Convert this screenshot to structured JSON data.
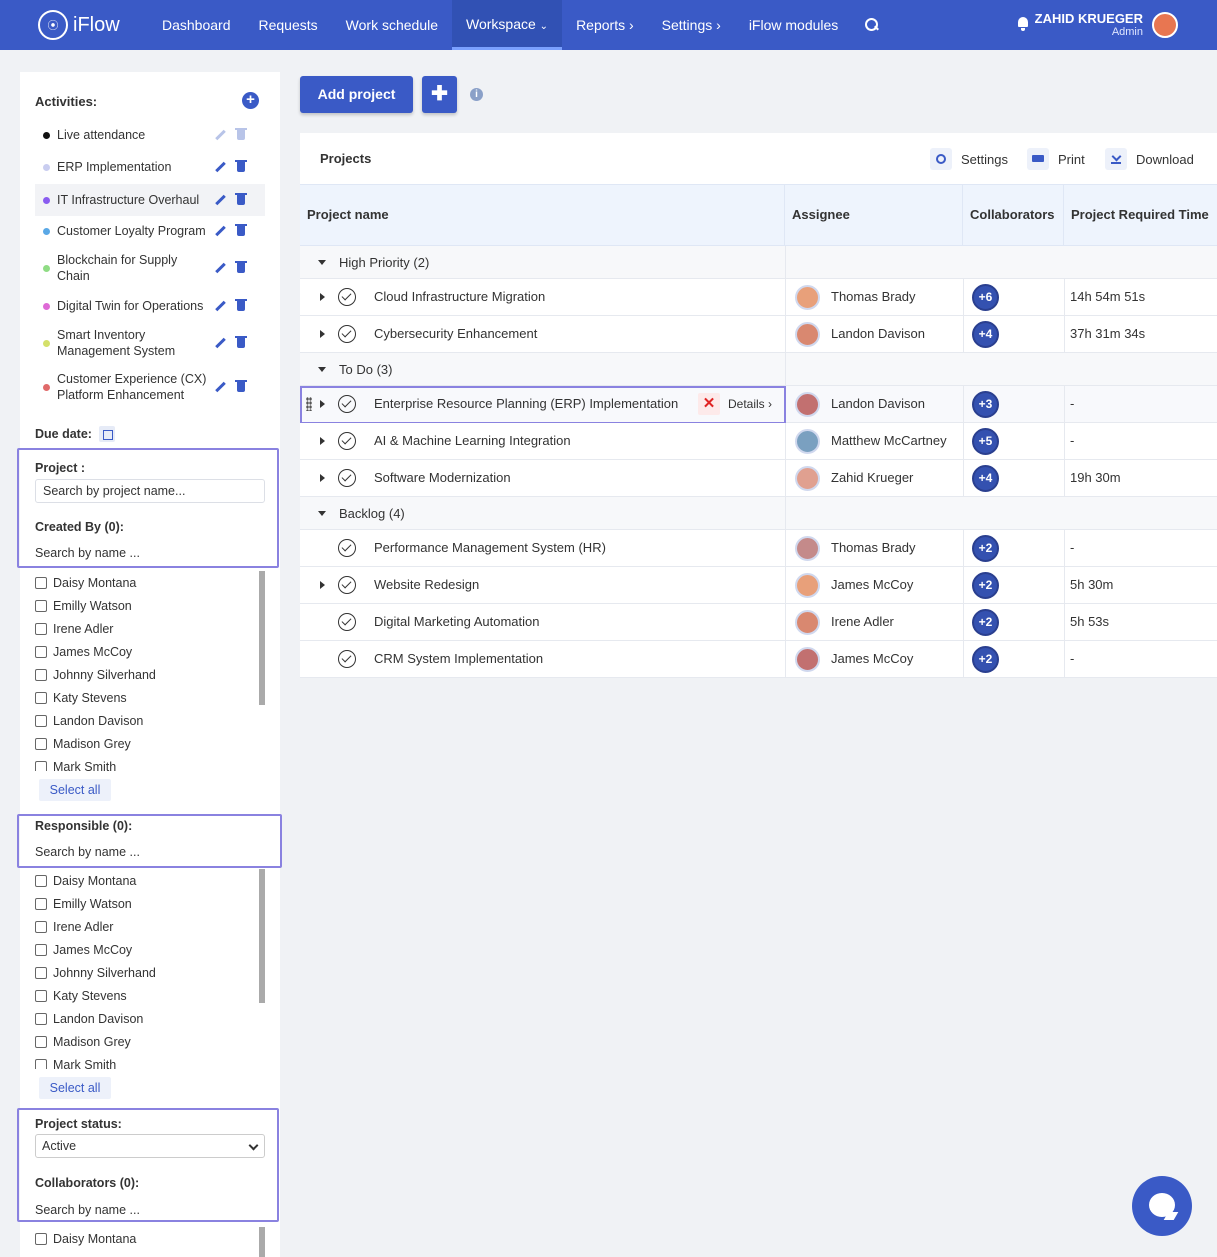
{
  "app": {
    "name": "iFlow"
  },
  "nav": {
    "items": [
      "Dashboard",
      "Requests",
      "Work schedule",
      "Workspace",
      "Reports",
      "Settings",
      "iFlow modules"
    ],
    "user_name": "ZAHID KRUEGER",
    "user_role": "Admin"
  },
  "sidebar": {
    "activities_title": "Activities:",
    "activities": [
      {
        "label": "Live attendance",
        "color": "#111111"
      },
      {
        "label": "ERP Implementation",
        "color": "#c9cdf0"
      },
      {
        "label": "IT Infrastructure Overhaul",
        "color": "#8a5cf0"
      },
      {
        "label": "Customer Loyalty Program",
        "color": "#5aa8e6"
      },
      {
        "label": "Blockchain for Supply Chain",
        "color": "#8fdc84"
      },
      {
        "label": "Digital Twin for Operations",
        "color": "#de6ad6"
      },
      {
        "label": "Smart Inventory Management System",
        "color": "#d4e06a"
      },
      {
        "label": "Customer Experience (CX) Platform Enhancement",
        "color": "#e06a6a"
      }
    ],
    "due_date_label": "Due date:",
    "project_label": "Project :",
    "project_placeholder": "Search by project name...",
    "created_by_label": "Created By (0):",
    "search_by_name": "Search by name ...",
    "people": [
      "Daisy Montana",
      "Emilly Watson",
      "Irene Adler",
      "James McCoy",
      "Johnny Silverhand",
      "Katy Stevens",
      "Landon Davison",
      "Madison Grey",
      "Mark Smith"
    ],
    "select_all": "Select all",
    "responsible_label": "Responsible (0):",
    "project_status_label": "Project status:",
    "project_status_value": "Active",
    "collaborators_label": "Collaborators (0):",
    "collab_first": "Daisy Montana"
  },
  "toolbar": {
    "add_project": "Add project",
    "plus": "✚"
  },
  "projects": {
    "title": "Projects",
    "settings": "Settings",
    "print": "Print",
    "download": "Download",
    "columns": [
      "Project name",
      "Assignee",
      "Collaborators",
      "Project Required Time"
    ],
    "groups": [
      {
        "label": "High Priority (2)",
        "rows": [
          {
            "name": "Cloud Infrastructure Migration",
            "assignee": "Thomas Brady",
            "collab": "+6",
            "time": "14h 54m 51s",
            "expand": true
          },
          {
            "name": "Cybersecurity Enhancement",
            "assignee": "Landon Davison",
            "collab": "+4",
            "time": "37h 31m 34s",
            "expand": true
          }
        ]
      },
      {
        "label": "To Do (3)",
        "rows": [
          {
            "name": "Enterprise Resource Planning (ERP) Implementation",
            "assignee": "Landon Davison",
            "collab": "+3",
            "time": "-",
            "expand": true
          },
          {
            "name": "AI & Machine Learning Integration",
            "assignee": "Matthew McCartney",
            "collab": "+5",
            "time": "-",
            "expand": true
          },
          {
            "name": "Software Modernization",
            "assignee": "Zahid Krueger",
            "collab": "+4",
            "time": "19h 30m",
            "expand": true
          }
        ]
      },
      {
        "label": "Backlog (4)",
        "rows": [
          {
            "name": "Performance Management System (HR)",
            "assignee": "Thomas Brady",
            "collab": "+2",
            "time": "-",
            "expand": false
          },
          {
            "name": "Website Redesign",
            "assignee": "James McCoy",
            "collab": "+2",
            "time": "5h 30m",
            "expand": true
          },
          {
            "name": "Digital Marketing Automation",
            "assignee": "Irene Adler",
            "collab": "+2",
            "time": "5h 53s",
            "expand": false
          },
          {
            "name": "CRM System Implementation",
            "assignee": "James McCoy",
            "collab": "+2",
            "time": "-",
            "expand": false
          }
        ]
      }
    ],
    "hover_actions": {
      "remove": "✕",
      "details": "Details"
    }
  }
}
